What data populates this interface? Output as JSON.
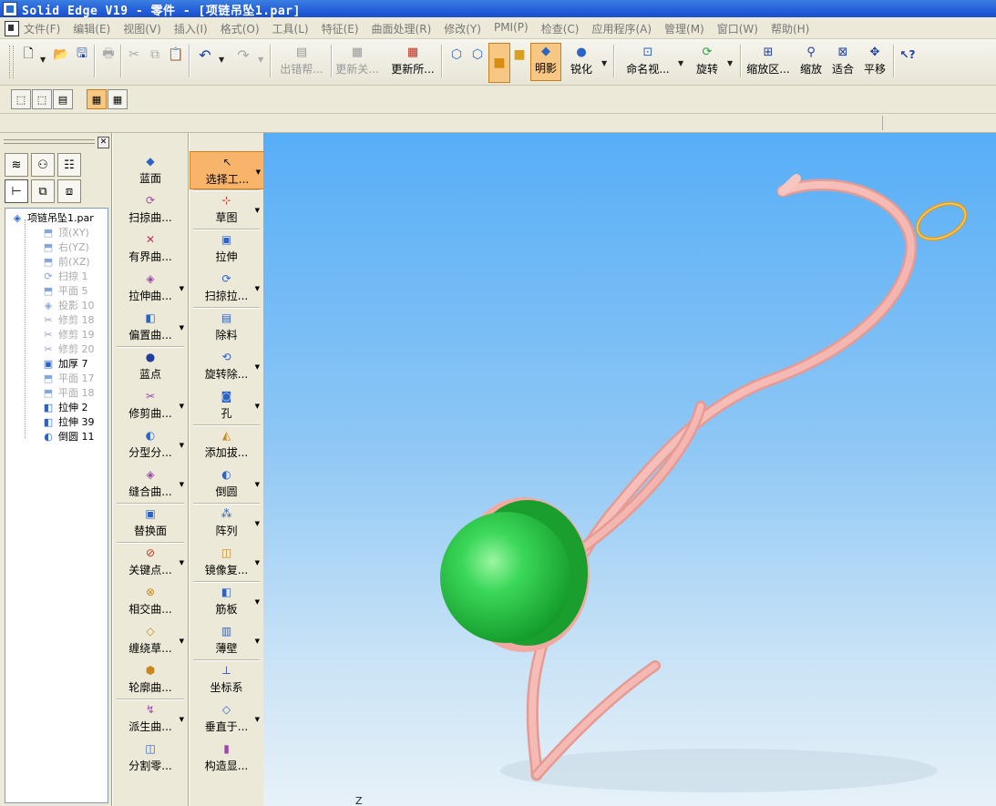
{
  "title": "Solid Edge V19 - 零件 - [项链吊坠1.par]",
  "menu": [
    "文件(F)",
    "编辑(E)",
    "视图(V)",
    "插入(I)",
    "格式(O)",
    "工具(L)",
    "特征(E)",
    "曲面处理(R)",
    "修改(Y)",
    "PMI(P)",
    "检查(C)",
    "应用程序(A)",
    "管理(M)",
    "窗口(W)",
    "帮助(H)"
  ],
  "toolbar": {
    "error_help": "出错帮...",
    "update_related": "更新关...",
    "update_all": "更新所...",
    "shading": "明影",
    "sharpen": "锐化",
    "named_view": "命名视...",
    "rotate": "旋转",
    "zoom_area": "缩放区...",
    "zoom": "缩放",
    "fit": "适合",
    "pan": "平移"
  },
  "tree": {
    "root": "项链吊坠1.par",
    "items": [
      {
        "label": "顶(XY)",
        "gray": true,
        "icon": "plane"
      },
      {
        "label": "右(YZ)",
        "gray": true,
        "icon": "plane"
      },
      {
        "label": "前(XZ)",
        "gray": true,
        "icon": "plane"
      },
      {
        "label": "扫掠 1",
        "gray": true,
        "icon": "sweep"
      },
      {
        "label": "平面 5",
        "gray": true,
        "icon": "plane"
      },
      {
        "label": "投影 10",
        "gray": true,
        "icon": "project"
      },
      {
        "label": "修剪 18",
        "gray": true,
        "icon": "trim"
      },
      {
        "label": "修剪 19",
        "gray": true,
        "icon": "trim"
      },
      {
        "label": "修剪 20",
        "gray": true,
        "icon": "trim"
      },
      {
        "label": "加厚 7",
        "gray": false,
        "icon": "thicken"
      },
      {
        "label": "平面 17",
        "gray": true,
        "icon": "plane"
      },
      {
        "label": "平面 18",
        "gray": true,
        "icon": "plane"
      },
      {
        "label": "拉伸 2",
        "gray": false,
        "icon": "extrude"
      },
      {
        "label": "拉伸 39",
        "gray": false,
        "icon": "extrude"
      },
      {
        "label": "倒圆 11",
        "gray": false,
        "icon": "round"
      }
    ]
  },
  "ribbon_surface": [
    "蓝面",
    "扫掠曲...",
    "有界曲...",
    "拉伸曲...",
    "偏置曲...",
    "蓝点",
    "修剪曲...",
    "分型分...",
    "缝合曲...",
    "替换面",
    "关键点...",
    "相交曲...",
    "缠绕草...",
    "轮廓曲...",
    "派生曲...",
    "分割零..."
  ],
  "ribbon_features": [
    "选择工...",
    "草图",
    "拉伸",
    "扫掠拉...",
    "除料",
    "旋转除...",
    "孔",
    "添加拔...",
    "倒圆",
    "阵列",
    "镜像复...",
    "筋板",
    "薄壁",
    "坐标系",
    "垂直于...",
    "构造显..."
  ],
  "viewport": {
    "axis_label": "Z"
  },
  "colors": {
    "pendant": "#f2b0aa",
    "gem": "#22c23a",
    "ring": "#e8a020",
    "sky_top": "#57aef7"
  }
}
